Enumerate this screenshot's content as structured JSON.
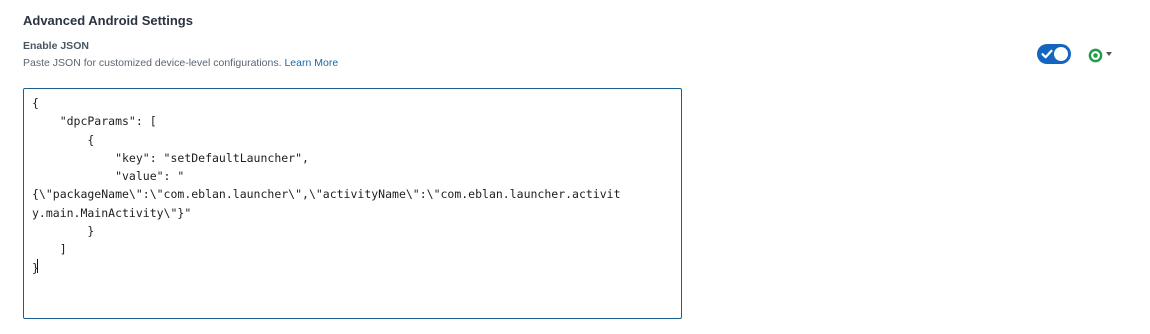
{
  "section": {
    "title": "Advanced Android Settings"
  },
  "field": {
    "label": "Enable JSON",
    "description": "Paste JSON for customized device-level configurations.",
    "learn_more": "Learn More"
  },
  "toggle": {
    "state": "on",
    "color": "#1565c0"
  },
  "status": {
    "icon": "active-status-icon",
    "color": "#1e9e4a"
  },
  "editor": {
    "lines": [
      "{",
      "    \"dpcParams\": [",
      "        {",
      "            \"key\": \"setDefaultLauncher\",",
      "            \"value\": \"",
      "{\\\"packageName\\\":\\\"com.eblan.launcher\\\",\\\"activityName\\\":\\\"com.eblan.launcher.activit",
      "y.main.MainActivity\\\"}\"",
      "        }",
      "    ]",
      "}"
    ]
  },
  "colors": {
    "border": "#1a5f8f",
    "link": "#1769aa"
  }
}
